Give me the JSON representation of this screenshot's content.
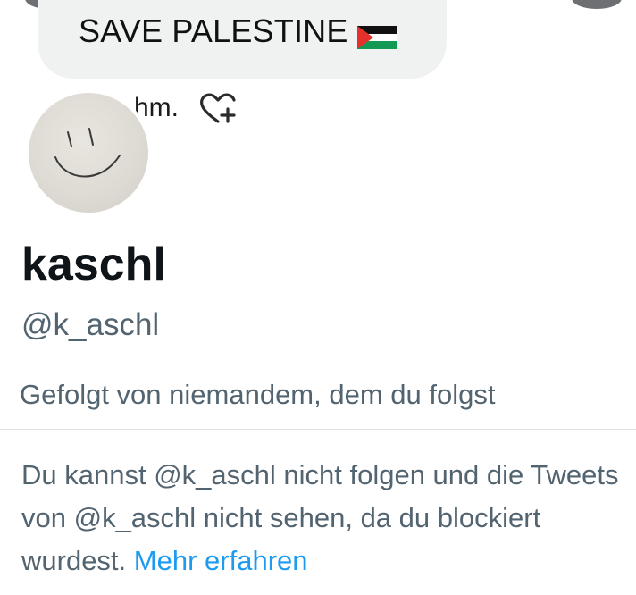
{
  "banner": {
    "text": "SAVE PALESTINE",
    "flag_icon": "palestine-flag-icon",
    "background": "#f0f2f2"
  },
  "bio_fragment": {
    "text": "hm.",
    "icon": "heart-plus-icon"
  },
  "profile": {
    "display_name": "kaschl",
    "handle": "@k_aschl",
    "followed_by": "Gefolgt von niemandem, dem du folgst",
    "avatar_icon": "smiley-avatar"
  },
  "blocked": {
    "message": "Du kannst @k_aschl nicht folgen und die Tweets von @k_aschl nicht sehen, da du blockiert wurdest.",
    "link_label": "Mehr erfahren",
    "link_color": "#1d9bf0"
  },
  "colors": {
    "primary_text": "#0f1419",
    "secondary_text": "#536471",
    "divider": "#dfe3e6"
  }
}
